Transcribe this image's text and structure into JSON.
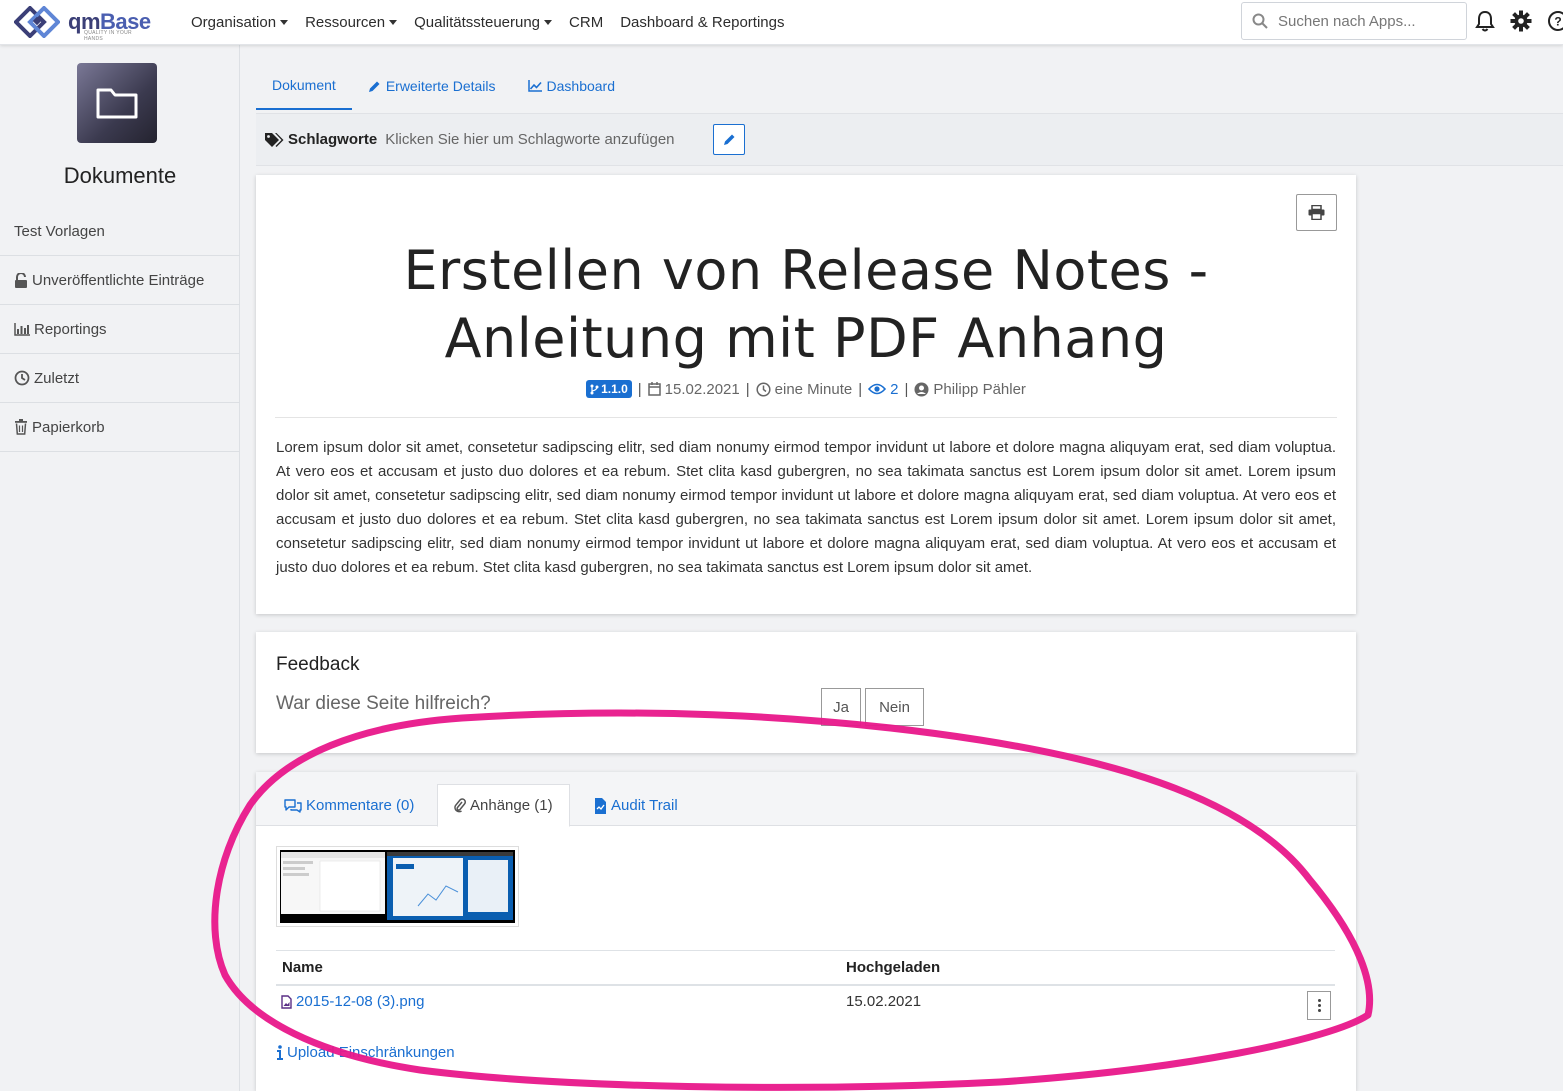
{
  "brand": {
    "name_part1": "qm",
    "name_part2": "Base",
    "tagline": "QUALITY IN YOUR HANDS"
  },
  "nav": {
    "items": [
      {
        "label": "Organisation",
        "dropdown": true
      },
      {
        "label": "Ressourcen",
        "dropdown": true
      },
      {
        "label": "Qualitätssteuerung",
        "dropdown": true
      },
      {
        "label": "CRM",
        "dropdown": false
      },
      {
        "label": "Dashboard & Reportings",
        "dropdown": false
      }
    ],
    "search_placeholder": "Suchen nach Apps...",
    "icons": [
      "bell-icon",
      "gear-icon",
      "help-icon"
    ]
  },
  "sidebar": {
    "title": "Dokumente",
    "logo_icon": "folder-icon",
    "items": [
      {
        "label": "Test Vorlagen",
        "icon": ""
      },
      {
        "label": "Unveröffentlichte Einträge",
        "icon": "unlock-icon"
      },
      {
        "label": "Reportings",
        "icon": "bar-chart-icon"
      },
      {
        "label": "Zuletzt",
        "icon": "clock-icon"
      },
      {
        "label": "Papierkorb",
        "icon": "trash-icon"
      }
    ]
  },
  "tabs": [
    {
      "label": "Dokument",
      "active": true,
      "icon": ""
    },
    {
      "label": "Erweiterte Details",
      "active": false,
      "icon": "pencil-icon"
    },
    {
      "label": "Dashboard",
      "active": false,
      "icon": "line-chart-icon"
    }
  ],
  "tags": {
    "label": "Schlagworte",
    "hint": "Klicken Sie hier um Schlagworte anzufügen"
  },
  "document": {
    "title": "Erstellen von Release Notes - Anleitung mit PDF Anhang",
    "version": "1.1.0",
    "date": "15.02.2021",
    "read_time": "eine Minute",
    "views": "2",
    "author": "Philipp Pähler",
    "body": "Lorem ipsum dolor sit amet, consetetur sadipscing elitr, sed diam nonumy eirmod tempor invidunt ut labore et dolore magna aliquyam erat, sed diam voluptua. At vero eos et accusam et justo duo dolores et ea rebum. Stet clita kasd gubergren, no sea takimata sanctus est Lorem ipsum dolor sit amet. Lorem ipsum dolor sit amet, consetetur sadipscing elitr, sed diam nonumy eirmod tempor invidunt ut labore et dolore magna aliquyam erat, sed diam voluptua. At vero eos et accusam et justo duo dolores et ea rebum. Stet clita kasd gubergren, no sea takimata sanctus est Lorem ipsum dolor sit amet. Lorem ipsum dolor sit amet, consetetur sadipscing elitr, sed diam nonumy eirmod tempor invidunt ut labore et dolore magna aliquyam erat, sed diam voluptua. At vero eos et accusam et justo duo dolores et ea rebum. Stet clita kasd gubergren, no sea takimata sanctus est Lorem ipsum dolor sit amet."
  },
  "feedback": {
    "title": "Feedback",
    "question": "War diese Seite hilfreich?",
    "yes": "Ja",
    "no": "Nein"
  },
  "attachments": {
    "tabs": [
      {
        "label": "Kommentare (0)",
        "icon": "comments-icon",
        "active": false
      },
      {
        "label": "Anhänge (1)",
        "icon": "paperclip-icon",
        "active": true
      },
      {
        "label": "Audit Trail",
        "icon": "file-audit-icon",
        "active": false
      }
    ],
    "columns": {
      "name": "Name",
      "uploaded": "Hochgeladen"
    },
    "rows": [
      {
        "name": "2015-12-08 (3).png",
        "uploaded": "15.02.2021"
      }
    ],
    "upload_link": "Upload Einschränkungen"
  },
  "colors": {
    "accent": "#1a6fd1",
    "highlight": "#e8178a"
  }
}
